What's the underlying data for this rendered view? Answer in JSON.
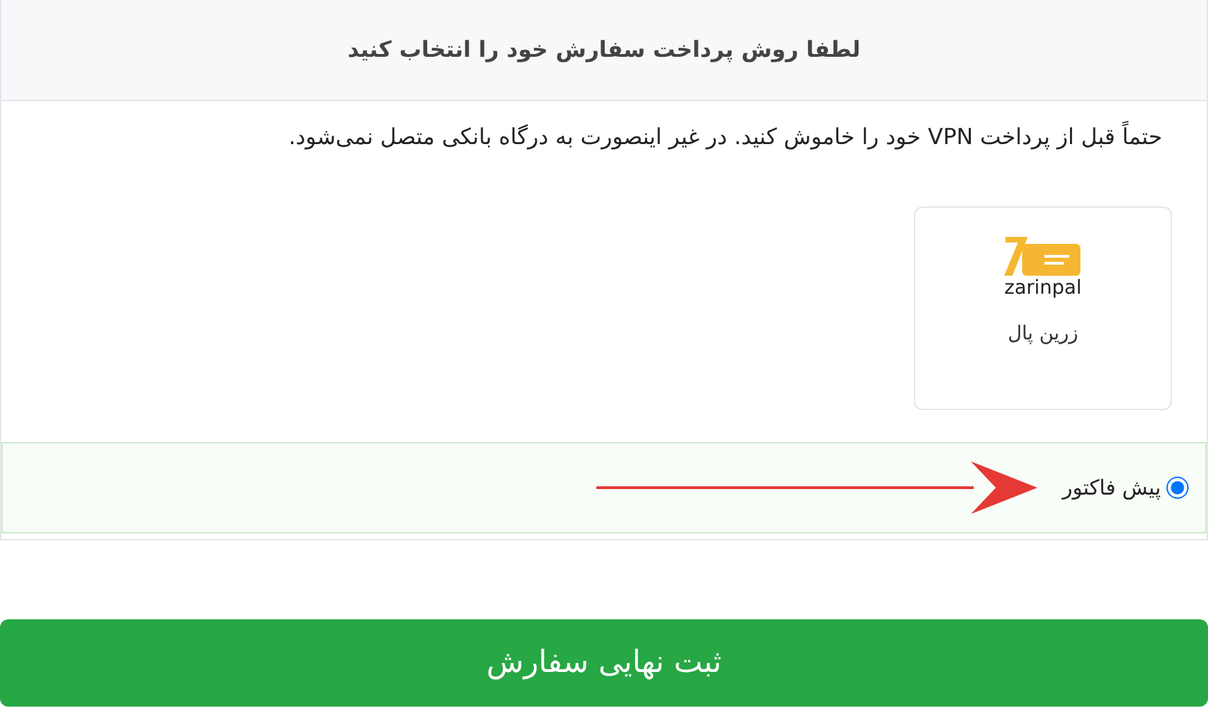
{
  "header": {
    "title": "لطفا روش پرداخت سفارش خود را انتخاب کنید"
  },
  "notice": "حتماً قبل از پرداخت VPN خود را خاموش کنید. در غیر اینصورت به درگاه بانکی متصل نمی‌شود.",
  "gateways": [
    {
      "logo_text": "zarinpal",
      "label": "زرین پال",
      "selected": false
    }
  ],
  "options": [
    {
      "label": "پیش فاکتور",
      "selected": true
    }
  ],
  "submit_button": "ثبت نهایی سفارش"
}
